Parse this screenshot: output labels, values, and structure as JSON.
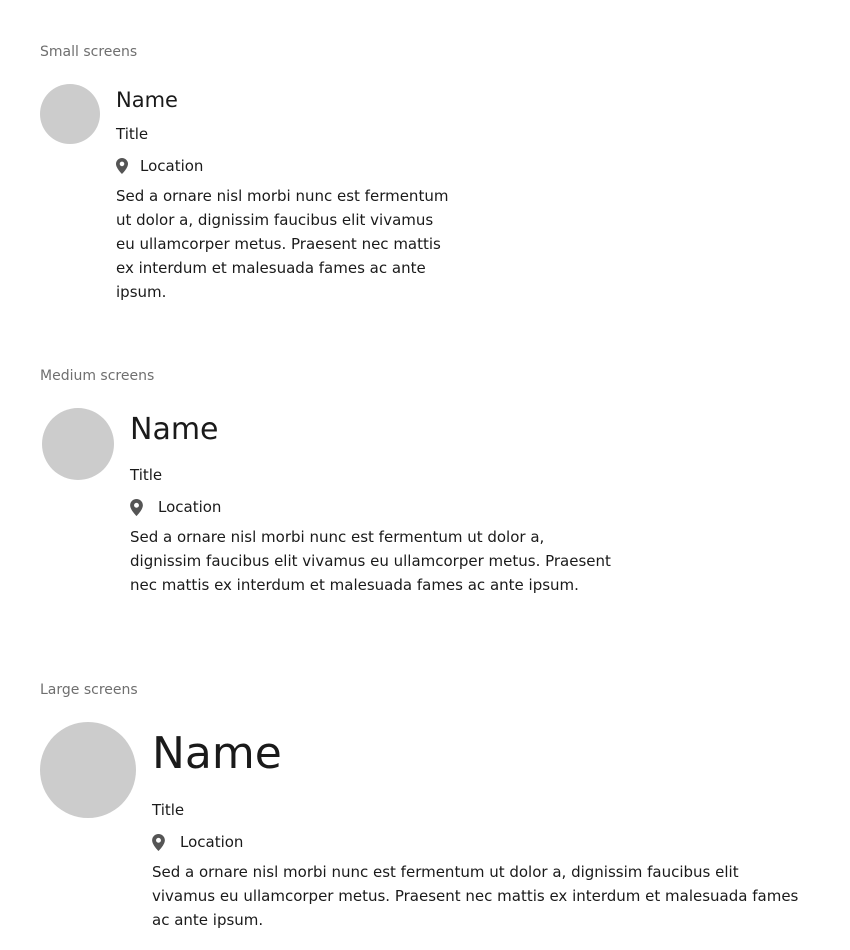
{
  "sections": {
    "small": {
      "label": "Small screens",
      "name": "Name",
      "title": "Title",
      "location": "Location",
      "description": "Sed a ornare nisl morbi nunc est fermentum ut dolor a, dignissim faucibus elit vivamus eu ullamcorper metus. Praesent nec mattis ex interdum et malesuada fames ac ante ipsum."
    },
    "medium": {
      "label": "Medium screens",
      "name": "Name",
      "title": "Title",
      "location": "Location",
      "description": "Sed a ornare nisl morbi nunc est fermentum ut dolor a, dignissim faucibus elit vivamus eu ullamcorper metus. Praesent nec mattis ex interdum et malesuada fames ac ante ipsum."
    },
    "large": {
      "label": "Large screens",
      "name": "Name",
      "title": "Title",
      "location": "Location",
      "description": "Sed a ornare nisl morbi nunc est fermentum ut dolor a, dignissim faucibus elit vivamus eu ullamcorper metus. Praesent nec mattis ex interdum et malesuada fames ac ante ipsum."
    }
  },
  "icons": {
    "location": "map-pin-icon"
  },
  "colors": {
    "avatar": "#cccccc",
    "label": "#6f6f6f",
    "text": "#1a1a1a",
    "icon": "#555555"
  }
}
